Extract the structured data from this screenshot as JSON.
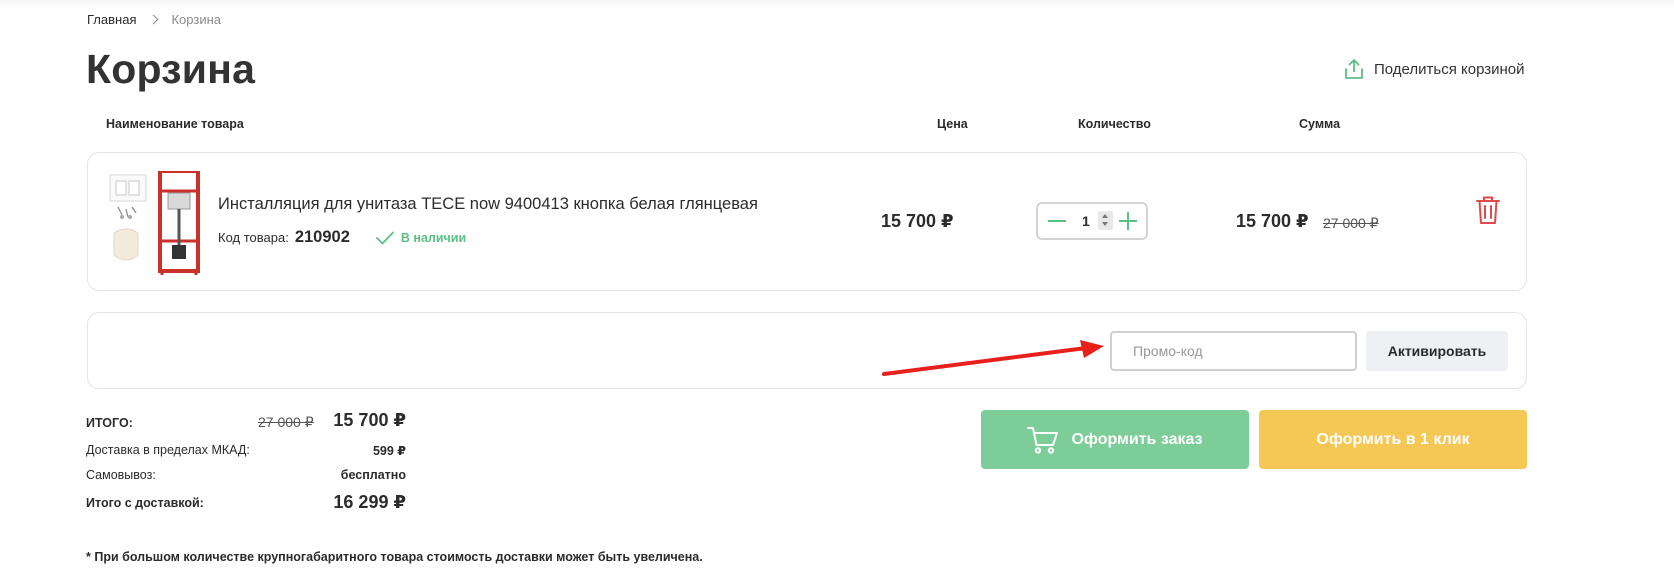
{
  "breadcrumb": {
    "home": "Главная",
    "current": "Корзина"
  },
  "page": {
    "title": "Корзина",
    "share_label": "Поделиться корзиной"
  },
  "columns": {
    "name": "Наименование товара",
    "price": "Цена",
    "quantity": "Количество",
    "sum": "Сумма"
  },
  "item": {
    "title": "Инсталляция для унитаза TECE now 9400413 кнопка белая глянцевая",
    "code_label": "Код товара:",
    "code": "210902",
    "stock": "В наличии",
    "price": "15 700 ₽",
    "quantity": "1",
    "sum": "15 700 ₽",
    "old_sum": "27 000 ₽"
  },
  "promo": {
    "placeholder": "Промо-код",
    "button": "Активировать"
  },
  "totals": {
    "total_label": "ИТОГО:",
    "total_old": "27 000 ₽",
    "total_new": "15 700 ₽",
    "delivery_label": "Доставка в пределах МКАД:",
    "delivery_value": "599 ₽",
    "pickup_label": "Самовывоз:",
    "pickup_value": "бесплатно",
    "with_delivery_label": "Итого с доставкой:",
    "with_delivery_value": "16 299 ₽"
  },
  "actions": {
    "order": "Оформить заказ",
    "one_click": "Оформить в 1 клик"
  },
  "footnote": "* При большом количестве крупногабаритного товара стоимость доставки может быть увеличена.",
  "colors": {
    "accent_green": "#7dcd98",
    "accent_yellow": "#f5c754",
    "delete_red": "#e04a4a",
    "annotation_arrow": "#e8201c"
  },
  "icons": {
    "share": "share-upload-icon",
    "stock": "check-icon",
    "delete": "trash-icon",
    "cart": "cart-icon"
  }
}
